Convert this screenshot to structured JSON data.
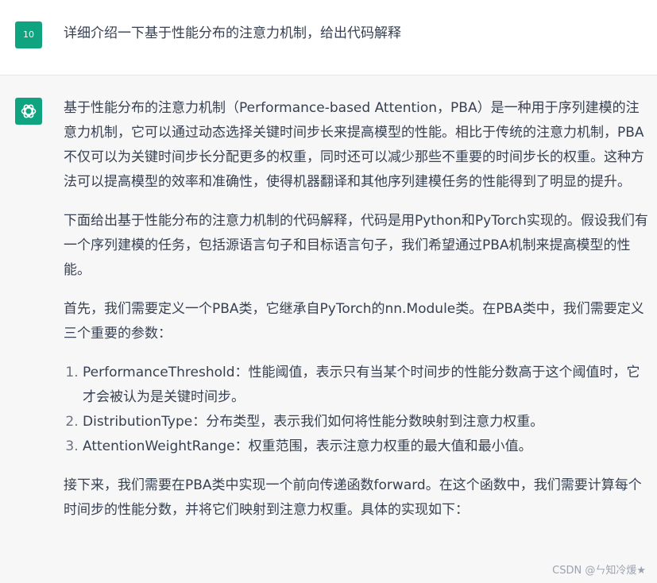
{
  "user_message": {
    "avatar_text": "10",
    "text": "详细介绍一下基于性能分布的注意力机制，给出代码解释"
  },
  "assistant_message": {
    "avatar_icon": "openai-logo-icon",
    "paragraphs": [
      "基于性能分布的注意力机制（Performance-based Attention，PBA）是一种用于序列建模的注意力机制，它可以通过动态选择关键时间步长来提高模型的性能。相比于传统的注意力机制，PBA不仅可以为关键时间步长分配更多的权重，同时还可以减少那些不重要的时间步长的权重。这种方法可以提高模型的效率和准确性，使得机器翻译和其他序列建模任务的性能得到了明显的提升。",
      "下面给出基于性能分布的注意力机制的代码解释，代码是用Python和PyTorch实现的。假设我们有一个序列建模的任务，包括源语言句子和目标语言句子，我们希望通过PBA机制来提高模型的性能。",
      "首先，我们需要定义一个PBA类，它继承自PyTorch的nn.Module类。在PBA类中，我们需要定义三个重要的参数："
    ],
    "list_items": [
      "PerformanceThreshold：性能阈值，表示只有当某个时间步的性能分数高于这个阈值时，它才会被认为是关键时间步。",
      "DistributionType：分布类型，表示我们如何将性能分数映射到注意力权重。",
      "AttentionWeightRange：权重范围，表示注意力权重的最大值和最小值。"
    ],
    "closing_paragraph": "接下来，我们需要在PBA类中实现一个前向传递函数forward。在这个函数中，我们需要计算每个时间步的性能分数，并将它们映射到注意力权重。具体的实现如下："
  },
  "watermark": "CSDN @ㄣ知冷煖★",
  "colors": {
    "accent": "#10a37f",
    "assistant_bg": "#f7f7f8",
    "text": "#374151"
  }
}
